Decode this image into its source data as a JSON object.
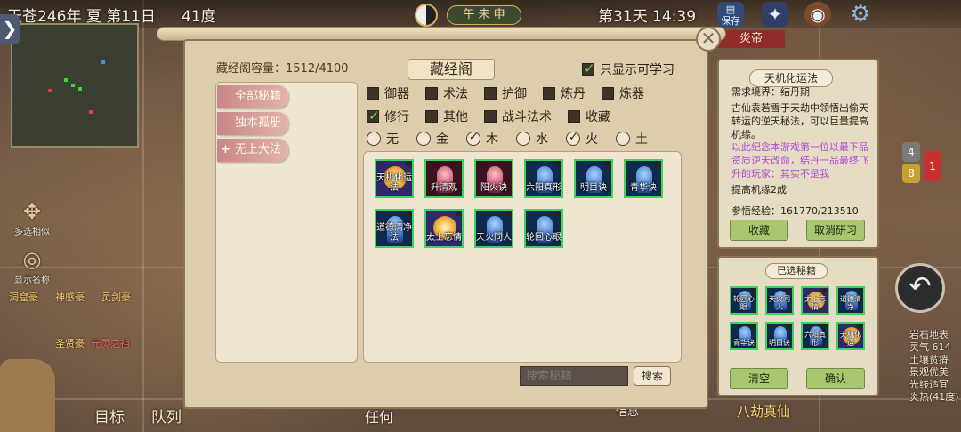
{
  "topbar": {
    "date": "天苍246年 夏 第11日",
    "temperature": "41度",
    "ganzhi": "午 未 申",
    "day_time": "第31天 14:39",
    "save_label": "保存",
    "banner": "炎帝"
  },
  "sidebar": {
    "collapse_glyph": "❯",
    "multi_select_label": "多选相似",
    "show_names_label": "显示名称",
    "nav_target": "目标",
    "nav_team": "队列"
  },
  "map_labels": [
    "洞窟豪",
    "神感豪",
    "灵剑豪",
    "圣贤豪",
    "元灵之祖",
    "八劫真仙",
    "任何",
    "信息"
  ],
  "dialog": {
    "capacity": "藏经阁容量：1512/4100",
    "title": "藏经阁",
    "only_learnable_label": "只显示可学习",
    "only_learnable_checked": true,
    "close_glyph": "✕",
    "categories": [
      {
        "label": "全部秘籍"
      },
      {
        "label": "独本孤册"
      },
      {
        "label": "无上大法"
      }
    ],
    "type_filters_row1": [
      {
        "label": "御器",
        "checked": false
      },
      {
        "label": "术法",
        "checked": false
      },
      {
        "label": "护御",
        "checked": false
      },
      {
        "label": "炼丹",
        "checked": false
      },
      {
        "label": "炼器",
        "checked": false
      }
    ],
    "type_filters_row2": [
      {
        "label": "修行",
        "checked": true
      },
      {
        "label": "其他",
        "checked": false
      },
      {
        "label": "战斗法术",
        "checked": false
      },
      {
        "label": "收藏",
        "checked": false
      }
    ],
    "element_filters": [
      {
        "label": "无",
        "checked": false
      },
      {
        "label": "金",
        "checked": false
      },
      {
        "label": "木",
        "checked": true
      },
      {
        "label": "水",
        "checked": false
      },
      {
        "label": "火",
        "checked": true
      },
      {
        "label": "土",
        "checked": false
      }
    ],
    "books": [
      {
        "name": "天机化运法",
        "style": "sun"
      },
      {
        "name": "升清观",
        "style": "red"
      },
      {
        "name": "阳火诀",
        "style": "red"
      },
      {
        "name": "六阳真形",
        "style": "blue"
      },
      {
        "name": "明目诀",
        "style": "blue"
      },
      {
        "name": "青华诀",
        "style": "blue"
      },
      {
        "name": "道德清净法",
        "style": "blue"
      },
      {
        "name": "太上忘情",
        "style": "sun"
      },
      {
        "name": "天火同人",
        "style": "blue"
      },
      {
        "name": "轮回心眼",
        "style": "blue"
      }
    ],
    "search_placeholder": "搜索秘籍",
    "search_button": "搜索"
  },
  "detail": {
    "title": "天机化运法",
    "requirement": "需求境界：结丹期",
    "description": "古仙袁若雪于天劫中领悟出偷天转运的逆天秘法，可以巨量提高机缘。",
    "note": "以此纪念本游戏第一位以最下品资质逆天改命，结丹一品最终飞升的玩家：其实不是我",
    "effect": "提高机缘2成",
    "exp": "参悟经验：161770/213510",
    "collect_button": "收藏",
    "cancel_button": "取消研习"
  },
  "selected": {
    "title": "已选秘籍",
    "books": [
      {
        "name": "轮回心眼",
        "style": "blue"
      },
      {
        "name": "天火同人",
        "style": "blue"
      },
      {
        "name": "太上忘情",
        "style": "sun"
      },
      {
        "name": "道德清净",
        "style": "blue"
      },
      {
        "name": "青华诀",
        "style": "blue"
      },
      {
        "name": "明目诀",
        "style": "blue"
      },
      {
        "name": "六阳真形",
        "style": "blue"
      },
      {
        "name": "天机化运",
        "style": "sun"
      }
    ],
    "clear_button": "清空",
    "confirm_button": "确认"
  },
  "right_info": [
    "岩石地表",
    "灵气 614",
    "土壤贫瘠",
    "景观优美",
    "光线适宜",
    "炎热(41度)"
  ],
  "badges": [
    "4",
    "8",
    "1"
  ],
  "colors": {
    "accent_green": "#3bd35c",
    "tab_pink": "#c98686",
    "button_green": "#a8c870"
  }
}
